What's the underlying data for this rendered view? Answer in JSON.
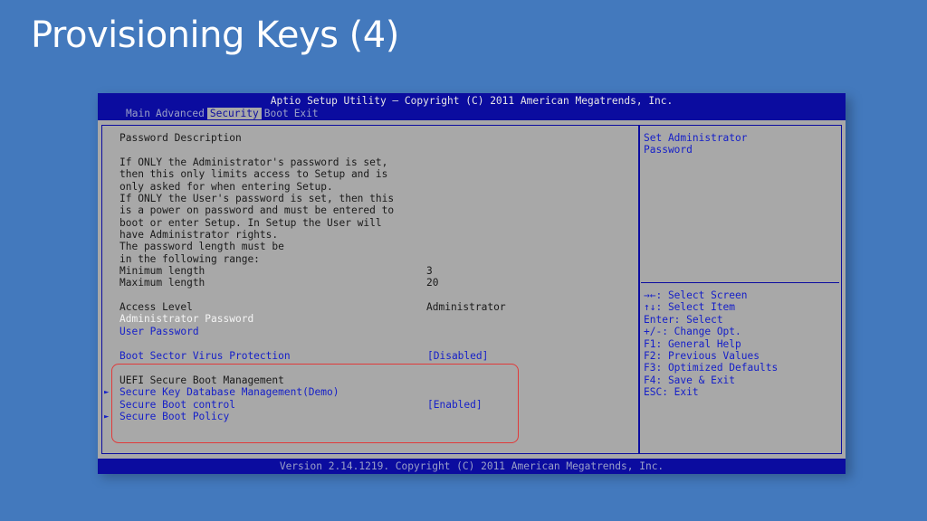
{
  "slide": {
    "title": "Provisioning Keys (4)"
  },
  "bios": {
    "title": "Aptio Setup Utility – Copyright (C) 2011 American Megatrends, Inc.",
    "menu": [
      "Main",
      "Advanced",
      "Security",
      "Boot",
      "Exit"
    ],
    "active_menu": "Security",
    "footer": "Version 2.14.1219. Copyright (C) 2011 American Megatrends, Inc.",
    "description": {
      "heading": "Password Description",
      "lines": [
        "If ONLY the Administrator's password is set,",
        "then this only limits access to Setup and is",
        "only asked for when entering Setup.",
        "If ONLY the User's password is set, then this",
        "is a power on password and must be entered to",
        "boot or enter Setup. In Setup the User will",
        "have Administrator rights.",
        "The password length must be",
        "in the following range:"
      ]
    },
    "settings": {
      "min_length_label": "Minimum length",
      "min_length_value": "3",
      "max_length_label": "Maximum length",
      "max_length_value": "20",
      "access_level_label": "Access Level",
      "access_level_value": "Administrator",
      "admin_password": "Administrator Password",
      "user_password": "User Password",
      "boot_sector_label": "Boot Sector Virus Protection",
      "boot_sector_value": "[Disabled]",
      "uefi_heading": "UEFI Secure Boot Management",
      "secure_key_db": "Secure Key Database Management(Demo)",
      "secure_boot_control_label": "Secure Boot control",
      "secure_boot_control_value": "[Enabled]",
      "secure_boot_policy": "Secure Boot Policy",
      "submenu_arrow": "►"
    },
    "help": {
      "item_help": [
        "Set Administrator",
        "Password"
      ],
      "keys": [
        "→←: Select Screen",
        "↑↓: Select Item",
        "Enter: Select",
        "+/-: Change Opt.",
        "F1: General Help",
        "F2: Previous Values",
        "F3: Optimized Defaults",
        "F4: Save & Exit",
        "ESC: Exit"
      ]
    }
  },
  "colors": {
    "background": "#4379bd",
    "bios_blue": "#0b0c9f",
    "bios_gray": "#a8a8a8",
    "highlight_box": "#e03a3a"
  }
}
